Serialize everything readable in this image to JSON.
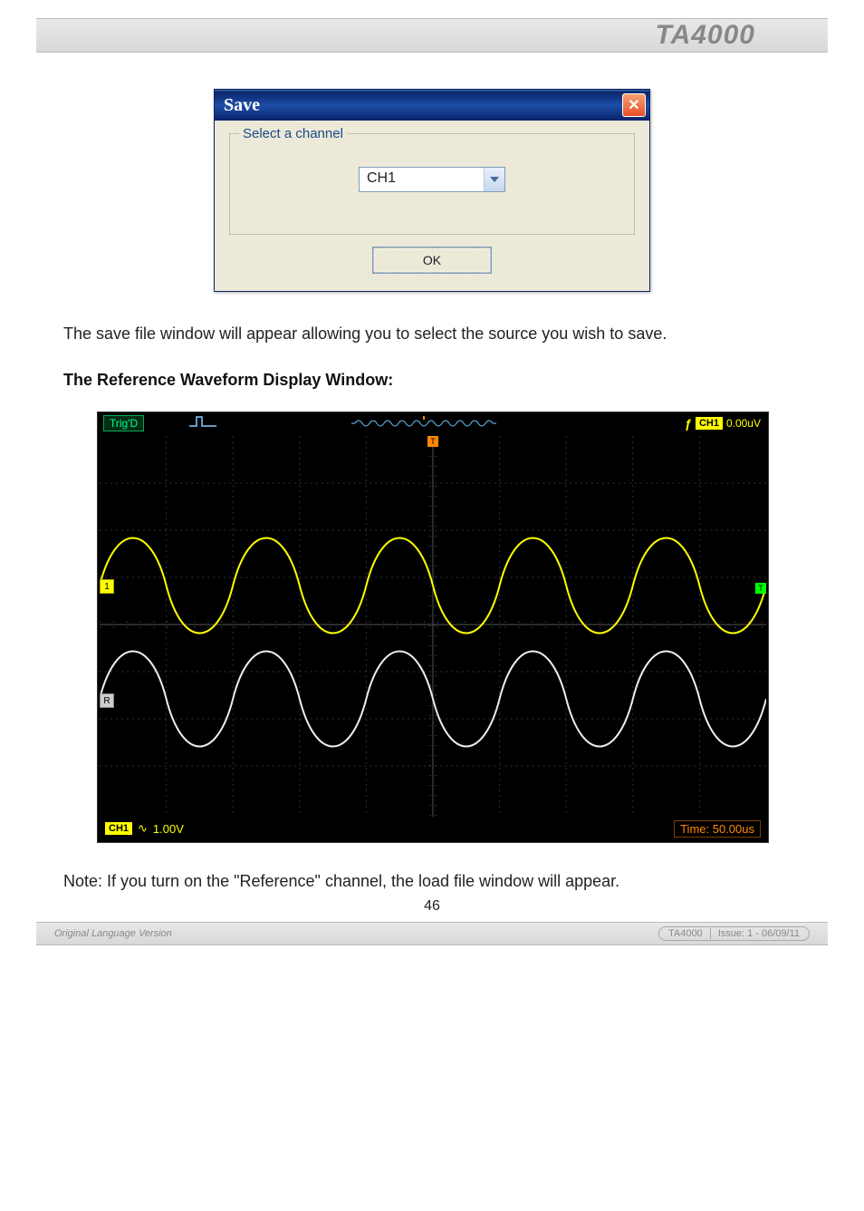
{
  "header": {
    "model": "TA4000"
  },
  "dialog": {
    "title": "Save",
    "close_glyph": "✕",
    "group_label": "Select a channel",
    "channel_value": "CH1",
    "ok_label": "OK"
  },
  "text": {
    "line1": "The save file window will appear allowing you to select the source you wish to save.",
    "section": "The Reference Waveform Display Window:",
    "note": "Note: If you turn on the \"Reference\" channel, the load file window will appear.",
    "page_number": "46"
  },
  "scope": {
    "trigd": "Trig'D",
    "top_marker": "T",
    "right_marker": "T",
    "edge_glyph": "ƒ",
    "ch_badge": "CH1",
    "trig_level": "0.00uV",
    "marker1": "1",
    "markerR": "R",
    "ch1_footer_badge": "CH1",
    "ch1_coupling": "∿",
    "ch1_scale": "1.00V",
    "time_scale": "Time: 50.00us"
  },
  "footer": {
    "left": "Original Language Version",
    "model": "TA4000",
    "issue": "Issue: 1 - 06/09/11"
  }
}
